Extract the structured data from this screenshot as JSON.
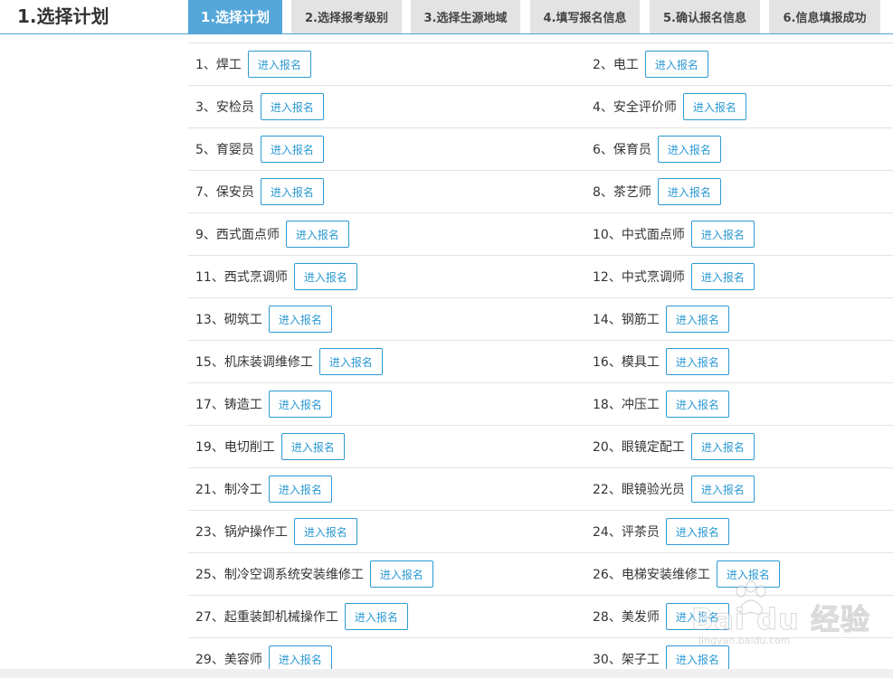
{
  "page_title": "1.选择计划",
  "steps": [
    {
      "label": "1.选择计划",
      "active": true
    },
    {
      "label": "2.选择报考级别",
      "active": false
    },
    {
      "label": "3.选择生源地域",
      "active": false
    },
    {
      "label": "4.填写报名信息",
      "active": false
    },
    {
      "label": "5.确认报名信息",
      "active": false
    },
    {
      "label": "6.信息填报成功",
      "active": false
    }
  ],
  "enroll_label": "进入报名",
  "jobs": [
    "1、焊工",
    "2、电工",
    "3、安检员",
    "4、安全评价师",
    "5、育婴员",
    "6、保育员",
    "7、保安员",
    "8、茶艺师",
    "9、西式面点师",
    "10、中式面点师",
    "11、西式烹调师",
    "12、中式烹调师",
    "13、砌筑工",
    "14、钢筋工",
    "15、机床装调维修工",
    "16、模具工",
    "17、铸造工",
    "18、冲压工",
    "19、电切削工",
    "20、眼镜定配工",
    "21、制冷工",
    "22、眼镜验光员",
    "23、锅炉操作工",
    "24、评茶员",
    "25、制冷空调系统安装维修工",
    "26、电梯安装维修工",
    "27、起重装卸机械操作工",
    "28、美发师",
    "29、美容师",
    "30、架子工"
  ],
  "watermark": {
    "text": "Bai du 经验",
    "sub": "jingyan.baidu.com"
  },
  "colors": {
    "accent": "#55a6da",
    "button_border": "#2d9ad3",
    "tab_bg": "#e3e3e3"
  }
}
